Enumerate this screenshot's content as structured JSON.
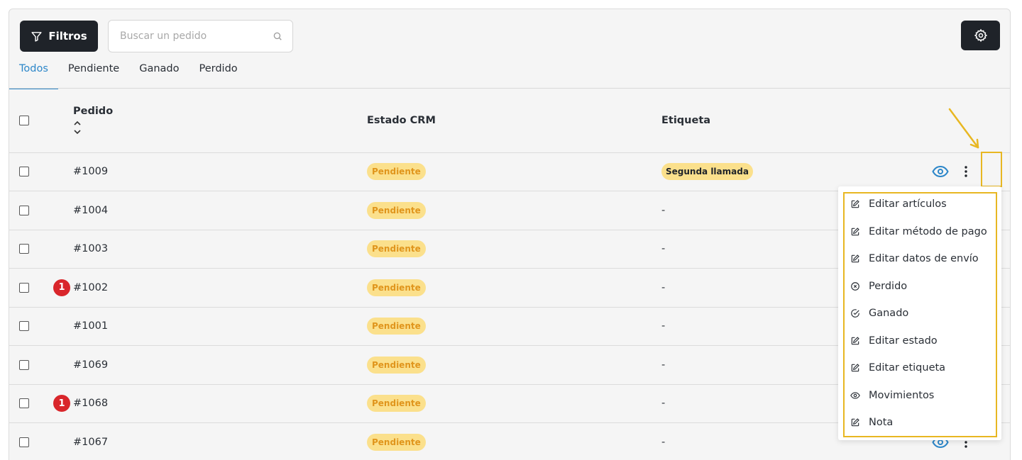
{
  "toolbar": {
    "filter_label": "Filtros",
    "search_placeholder": "Buscar un pedido"
  },
  "tabs": [
    {
      "label": "Todos",
      "active": true
    },
    {
      "label": "Pendiente",
      "active": false
    },
    {
      "label": "Ganado",
      "active": false
    },
    {
      "label": "Perdido",
      "active": false
    }
  ],
  "table": {
    "headers": {
      "order": "Pedido",
      "state": "Estado CRM",
      "tag": "Etiqueta"
    },
    "rows": [
      {
        "order": "#1009",
        "alert": "",
        "state": "Pendiente",
        "tag": "Segunda llamada"
      },
      {
        "order": "#1004",
        "alert": "",
        "state": "Pendiente",
        "tag": "-"
      },
      {
        "order": "#1003",
        "alert": "",
        "state": "Pendiente",
        "tag": "-"
      },
      {
        "order": "#1002",
        "alert": "1",
        "state": "Pendiente",
        "tag": "-"
      },
      {
        "order": "#1001",
        "alert": "",
        "state": "Pendiente",
        "tag": "-"
      },
      {
        "order": "#1069",
        "alert": "",
        "state": "Pendiente",
        "tag": "-"
      },
      {
        "order": "#1068",
        "alert": "1",
        "state": "Pendiente",
        "tag": "-"
      },
      {
        "order": "#1067",
        "alert": "",
        "state": "Pendiente",
        "tag": "-"
      }
    ]
  },
  "menu": {
    "items": [
      {
        "label": "Editar artículos",
        "icon": "edit-icon"
      },
      {
        "label": "Editar método de pago",
        "icon": "edit-icon"
      },
      {
        "label": "Editar datos de envío",
        "icon": "edit-icon"
      },
      {
        "label": "Perdido",
        "icon": "x-circle-icon"
      },
      {
        "label": "Ganado",
        "icon": "check-circle-icon"
      },
      {
        "label": "Editar estado",
        "icon": "edit-icon"
      },
      {
        "label": "Editar etiqueta",
        "icon": "edit-icon"
      },
      {
        "label": "Movimientos",
        "icon": "eye-icon"
      },
      {
        "label": "Nota",
        "icon": "edit-icon"
      }
    ]
  },
  "colors": {
    "accent": "#2d87c9",
    "dark_button": "#1f2329",
    "pill_bg": "#fbe08c",
    "pill_text": "#e0951c",
    "alert_red": "#d9262b",
    "annotation_yellow": "#e8b722"
  }
}
